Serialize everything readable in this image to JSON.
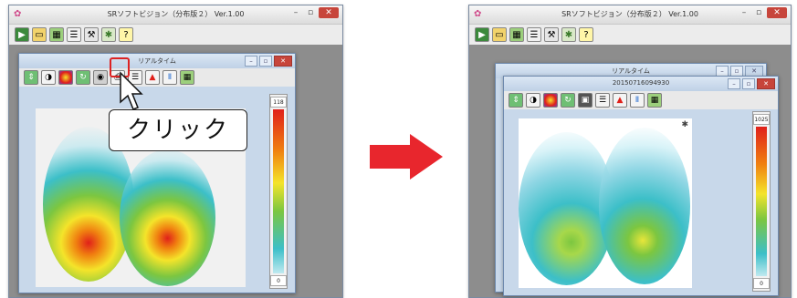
{
  "left_window": {
    "title": "SRソフトビジョン（分布版２） Ver.1.00",
    "controls": {
      "minimize": "–",
      "maximize": "▫",
      "close": "✕"
    },
    "toolbar_icons": [
      "play-icon",
      "folder-icon",
      "grid-icon",
      "list-icon",
      "wrench-icon",
      "gear-icon",
      "help-icon"
    ],
    "sub_window": {
      "title": "リアルタイム",
      "toolbar_icons": [
        "rotate-icon",
        "palette-icon",
        "color-wheel-icon",
        "refresh-icon",
        "snapshot-icon",
        "print-icon",
        "list-icon",
        "bar-chart-icon",
        "multi-color-icon",
        "grid-icon"
      ],
      "scale_top": "118",
      "scale_bottom": "0"
    }
  },
  "callout": {
    "text": "クリック"
  },
  "right_window": {
    "title": "SRソフトビジョン（分布版２） Ver.1.00",
    "controls": {
      "minimize": "–",
      "maximize": "▫",
      "close": "✕"
    },
    "back_window_title": "リアルタイム",
    "front_window_title": "20150716094930",
    "toolbar_icons": [
      "rotate-icon",
      "palette-icon",
      "color-wheel-icon",
      "refresh-icon",
      "save-icon",
      "list-icon",
      "bar-chart-icon",
      "multi-color-icon",
      "grid-icon"
    ],
    "scale_top": "1025",
    "scale_bottom": "0"
  },
  "colors": {
    "accent_arrow": "#e8262d",
    "highlight": "#dd2222"
  }
}
